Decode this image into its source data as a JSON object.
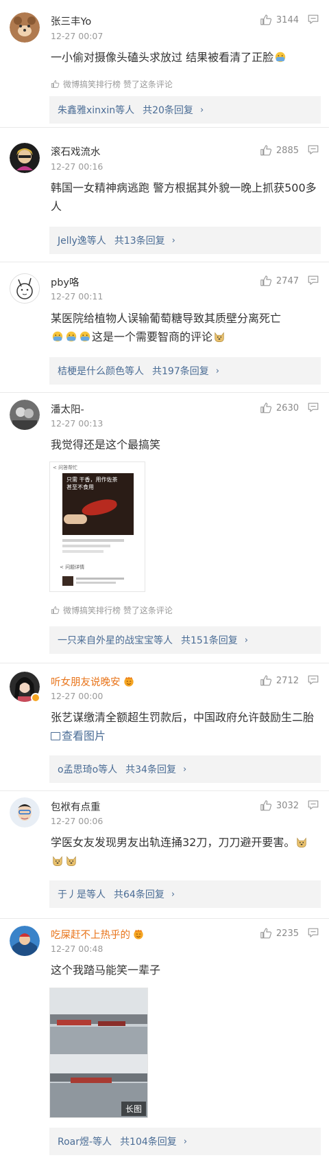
{
  "colors": {
    "link": "#4a6c95",
    "vip_name": "#e8741a",
    "meta": "#999999",
    "reply_bg": "#f3f3f3"
  },
  "comments": [
    {
      "username": "张三丰Yo",
      "time": "12-27 00:07",
      "likes": "3144",
      "text": "一小偷对摄像头磕头求放过 结果被看清了正脸",
      "praise": "微博搞笑排行榜 赞了这条评论",
      "reply_from": "朱鑫雅xinxin等人",
      "reply_count": "共20条回复"
    },
    {
      "username": "滚石戏流水",
      "time": "12-27 00:16",
      "likes": "2885",
      "text": "韩国一女精神病逃跑  警方根据其外貌一晚上抓获500多人",
      "reply_from": "Jelly逸等人",
      "reply_count": "共13条回复"
    },
    {
      "username": "pby咯",
      "time": "12-27 00:11",
      "likes": "2747",
      "text": "某医院给植物人误输葡萄糖导致其质壁分离死亡",
      "text_line2": "这是一个需要智商的评论",
      "reply_from": "桔梗是什么颜色等人",
      "reply_count": "共197条回复"
    },
    {
      "username": "潘太阳-",
      "time": "12-27 00:13",
      "likes": "2630",
      "text": "我觉得还是这个最搞笑",
      "praise": "微博搞笑排行榜 赞了这条评论",
      "reply_from": "一只来自外星的战宝宝等人",
      "reply_count": "共151条回复",
      "image_texts": {
        "header": "< 问答帮忙",
        "overlay_1": "只需 干香，用作佐茶",
        "overlay_2": "甚至不食用",
        "toolbar": "< 问题详情"
      }
    },
    {
      "username": "听女朋友说晚安",
      "time": "12-27 00:00",
      "likes": "2712",
      "text": "张艺谋缴清全额超生罚款后，中国政府允许鼓励生二胎",
      "view_image": "查看图片",
      "reply_from": "o孟思琦o等人",
      "reply_count": "共34条回复"
    },
    {
      "username": "包袱有点重",
      "time": "12-27 00:06",
      "likes": "3032",
      "text": "学医女友发现男友出轨连捅32刀，刀刀避开要害。",
      "reply_from": "于丿是等人",
      "reply_count": "共64条回复"
    },
    {
      "username": "吃屎赶不上热乎的",
      "time": "12-27 00:48",
      "likes": "2235",
      "text": "这个我踏马能笑一辈子",
      "long_image_tag": "长图",
      "reply_from": "Roar煜-等人",
      "reply_count": "共104条回复"
    }
  ],
  "icons": {
    "like": "thumbs-up-icon",
    "reply": "comment-bubble-icon",
    "praise": "thumbs-up-outline-icon",
    "chevron": "›"
  }
}
